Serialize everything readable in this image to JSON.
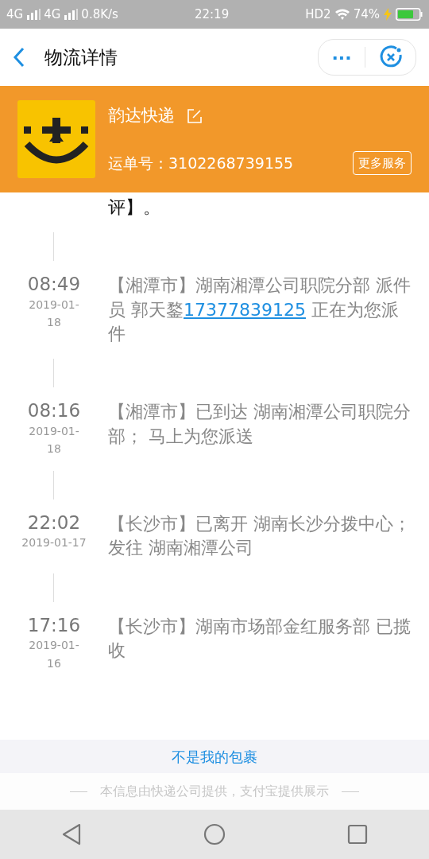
{
  "status_bar": {
    "left": [
      "4G",
      "4G",
      "0.8K/s"
    ],
    "time": "22:19",
    "hd": "HD2",
    "battery": "74%"
  },
  "header": {
    "title": "物流详情",
    "menu": "···"
  },
  "courier": {
    "name": "韵达快递",
    "tracking_label": "运单号：",
    "tracking_number": "3102268739155",
    "more": "更多服务"
  },
  "events": [
    {
      "current": true,
      "parts": [
        {
          "kind": "plain",
          "text": "评】。"
        }
      ]
    },
    {
      "current": false,
      "time": "08:49",
      "date_lines": [
        "2019-01-",
        "18"
      ],
      "parts": [
        {
          "kind": "plain",
          "text": "【湘潭市】湖南湘潭公司职院分部 派件员 郭天鍪"
        },
        {
          "kind": "phone",
          "text": "17377839125"
        },
        {
          "kind": "plain",
          "text": " 正在为您派件"
        }
      ]
    },
    {
      "current": false,
      "time": "08:16",
      "date_lines": [
        "2019-01-",
        "18"
      ],
      "parts": [
        {
          "kind": "plain",
          "text": "【湘潭市】已到达 湖南湘潭公司职院分部； 马上为您派送"
        }
      ]
    },
    {
      "current": false,
      "time": "22:02",
      "date_lines": [
        "2019-01-17"
      ],
      "parts": [
        {
          "kind": "plain",
          "text": "【长沙市】已离开 湖南长沙分拨中心；发往 湖南湘潭公司"
        }
      ]
    },
    {
      "current": false,
      "time": "17:16",
      "date_lines": [
        "2019-01-",
        "16"
      ],
      "parts": [
        {
          "kind": "plain",
          "text": "【长沙市】湖南市场部金红服务部 已揽收"
        }
      ]
    }
  ],
  "not_mine": "不是我的包裹",
  "footer_note": "本信息由快递公司提供，支付宝提供展示"
}
